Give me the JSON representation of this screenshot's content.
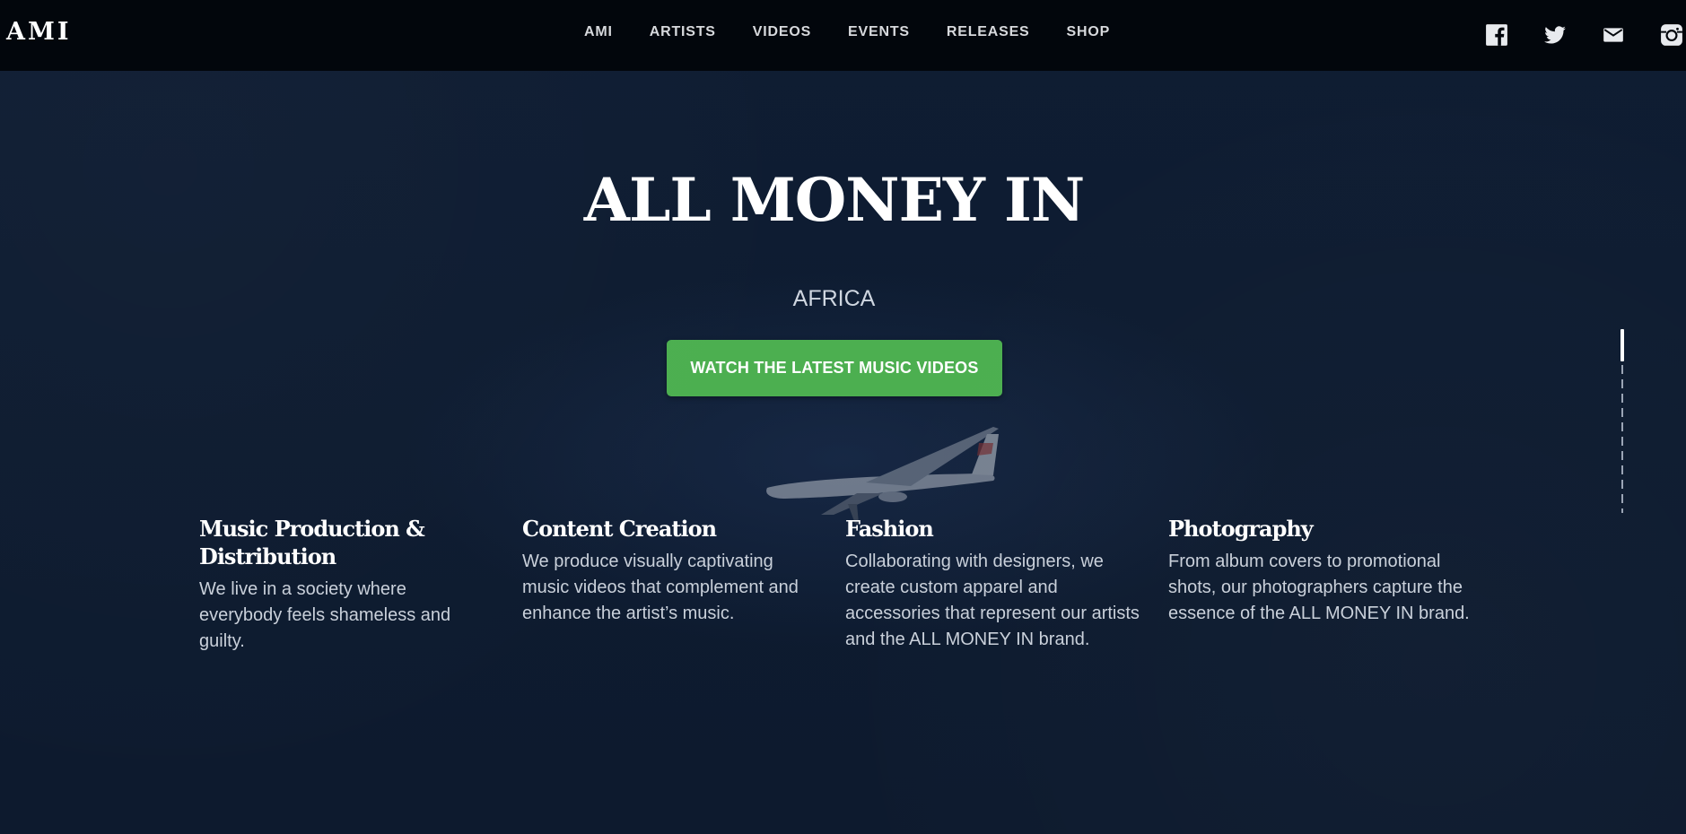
{
  "header": {
    "logo": "AMI",
    "nav": [
      "AMI",
      "ARTISTS",
      "VIDEOS",
      "EVENTS",
      "RELEASES",
      "SHOP"
    ],
    "socials": [
      {
        "name": "facebook-icon"
      },
      {
        "name": "twitter-icon"
      },
      {
        "name": "mail-icon"
      },
      {
        "name": "instagram-icon"
      }
    ]
  },
  "hero": {
    "title": "ALL MONEY IN",
    "subtitle": "AFRICA",
    "cta": "WATCH THE LATEST MUSIC VIDEOS"
  },
  "services": [
    {
      "title": "Music Production & Distribution",
      "text": "We live in a society where everybody feels shameless and guilty."
    },
    {
      "title": "Content Creation",
      "text": "We produce visually captivating music videos that complement and enhance the artist’s music."
    },
    {
      "title": "Fashion",
      "text": "Collaborating with designers, we create custom apparel and accessories that represent our artists and the ALL MONEY IN brand."
    },
    {
      "title": "Photography",
      "text": "From album covers to promotional shots, our photographers capture the essence of the ALL MONEY IN brand."
    }
  ],
  "colors": {
    "background": "#0d1a2d",
    "header": "#02060c",
    "accent": "#4caf50"
  }
}
